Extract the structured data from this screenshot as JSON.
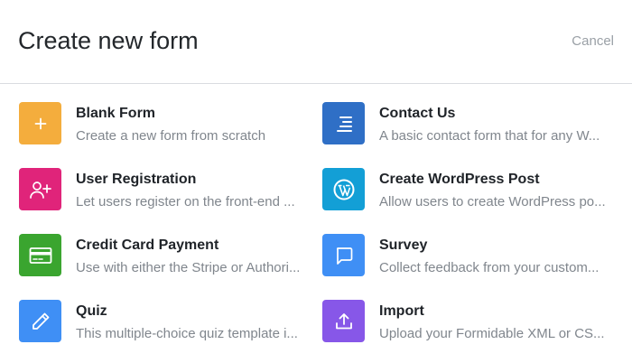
{
  "header": {
    "title": "Create new form",
    "cancel_label": "Cancel"
  },
  "templates": [
    {
      "name": "Blank Form",
      "description": "Create a new form from scratch",
      "icon": "plus-icon",
      "color": "#f4ad3d"
    },
    {
      "name": "Contact Us",
      "description": "A basic contact form that for any W...",
      "icon": "align-right-icon",
      "color": "#2f6fc6"
    },
    {
      "name": "User Registration",
      "description": "Let users register on the front-end ...",
      "icon": "add-user-icon",
      "color": "#e0247a"
    },
    {
      "name": "Create WordPress Post",
      "description": "Allow users to create WordPress po...",
      "icon": "wordpress-icon",
      "color": "#139fd6"
    },
    {
      "name": "Credit Card Payment",
      "description": "Use with either the Stripe or Authori...",
      "icon": "credit-card-icon",
      "color": "#3aa52f"
    },
    {
      "name": "Survey",
      "description": "Collect feedback from your custom...",
      "icon": "chat-bubble-icon",
      "color": "#3f8ff5"
    },
    {
      "name": "Quiz",
      "description": "This multiple-choice quiz template i...",
      "icon": "pencil-icon",
      "color": "#3f8ff5"
    },
    {
      "name": "Import",
      "description": "Upload your Formidable XML or CS...",
      "icon": "upload-icon",
      "color": "#8757e8"
    }
  ]
}
